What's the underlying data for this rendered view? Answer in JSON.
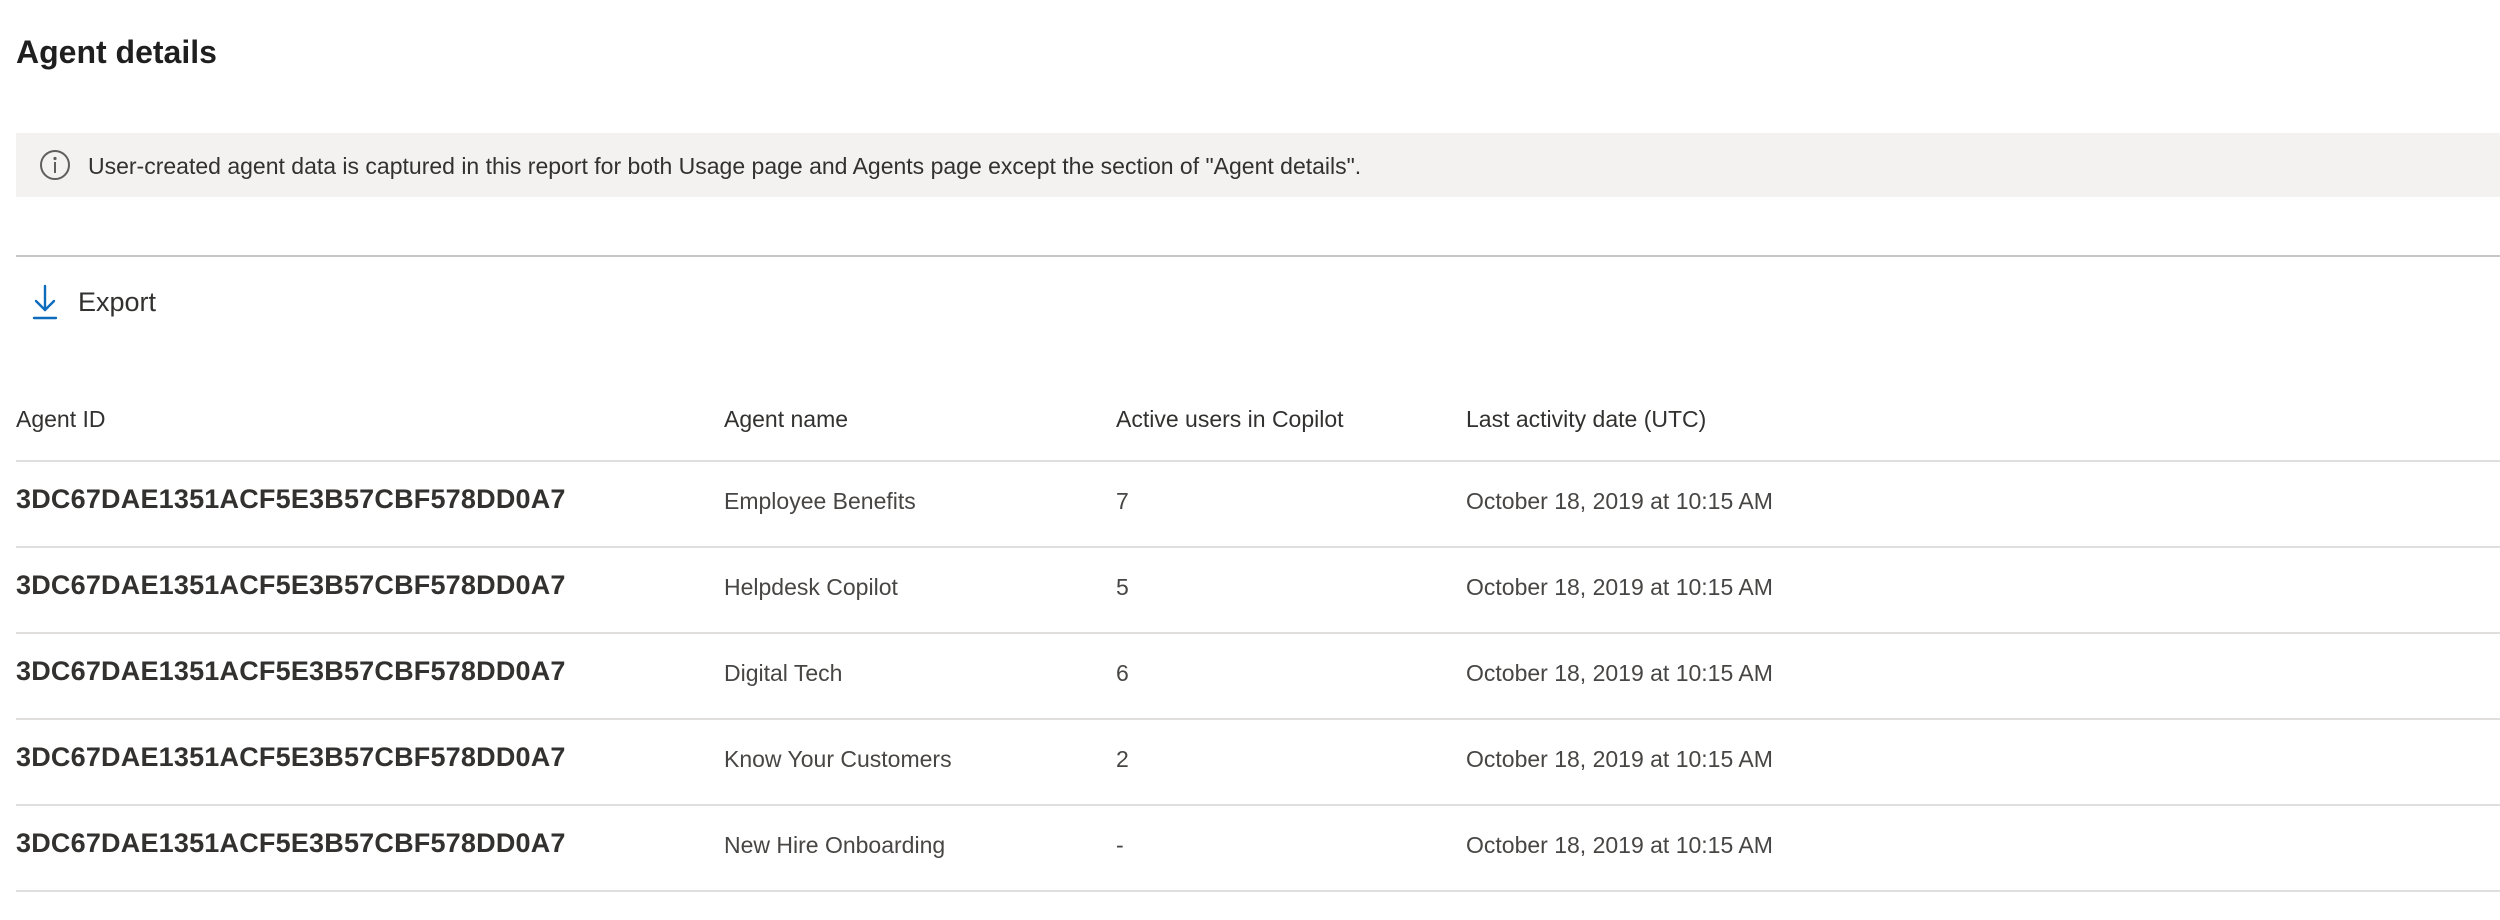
{
  "page": {
    "title": "Agent details"
  },
  "info_banner": {
    "icon": "info-icon",
    "text": "User-created agent data is captured in this report for both Usage page and Agents page except the section of \"Agent details\"."
  },
  "toolbar": {
    "export_icon": "download-icon",
    "export_label": "Export"
  },
  "table": {
    "columns": [
      "Agent ID",
      "Agent name",
      "Active users in Copilot",
      "Last activity date (UTC)"
    ],
    "rows": [
      {
        "agent_id": "3DC67DAE1351ACF5E3B57CBF578DD0A7",
        "agent_name": "Employee Benefits",
        "active_users": "7",
        "last_activity": "October 18, 2019 at 10:15 AM"
      },
      {
        "agent_id": "3DC67DAE1351ACF5E3B57CBF578DD0A7",
        "agent_name": "Helpdesk Copilot",
        "active_users": "5",
        "last_activity": "October 18, 2019 at 10:15 AM"
      },
      {
        "agent_id": "3DC67DAE1351ACF5E3B57CBF578DD0A7",
        "agent_name": "Digital Tech",
        "active_users": "6",
        "last_activity": "October 18, 2019 at 10:15 AM"
      },
      {
        "agent_id": "3DC67DAE1351ACF5E3B57CBF578DD0A7",
        "agent_name": "Know Your Customers",
        "active_users": "2",
        "last_activity": "October 18, 2019 at 10:15 AM"
      },
      {
        "agent_id": "3DC67DAE1351ACF5E3B57CBF578DD0A7",
        "agent_name": "New Hire Onboarding",
        "active_users": "-",
        "last_activity": "October 18, 2019 at 10:15 AM"
      }
    ]
  },
  "colors": {
    "accent": "#0f6cbd",
    "banner_bg": "#f3f2f1",
    "text": "#323130",
    "divider": "#e1dfdd"
  }
}
